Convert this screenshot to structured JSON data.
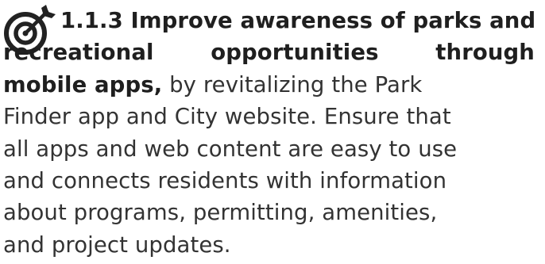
{
  "heading": {
    "number": "1.1.3",
    "title_line1": "Improve awareness of parks and",
    "title_line2_words": [
      "recreational",
      "opportunities",
      "through"
    ],
    "title_line3": "mobile apps,"
  },
  "body": {
    "line3_rest": " by revitalizing the Park",
    "line4": "Finder app and City website. Ensure that",
    "line5": "all apps and web content are easy to use",
    "line6": "and connects residents with information",
    "line7": "about programs, permitting, amenities,",
    "line8": "and project updates."
  },
  "icon": {
    "name": "target-arrow-icon",
    "color": "#222222"
  }
}
